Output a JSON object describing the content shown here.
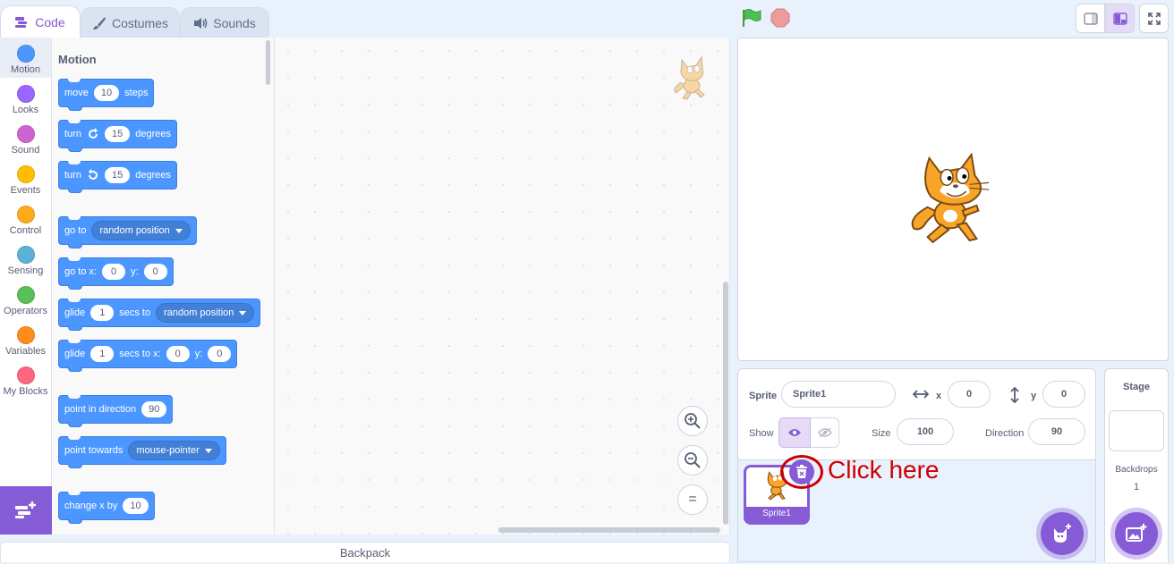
{
  "tabs": {
    "code": "Code",
    "costumes": "Costumes",
    "sounds": "Sounds"
  },
  "categories": [
    {
      "label": "Motion",
      "color": "#4c97ff"
    },
    {
      "label": "Looks",
      "color": "#9966ff"
    },
    {
      "label": "Sound",
      "color": "#cf63cf"
    },
    {
      "label": "Events",
      "color": "#ffbf00"
    },
    {
      "label": "Control",
      "color": "#ffab19"
    },
    {
      "label": "Sensing",
      "color": "#5cb1d6"
    },
    {
      "label": "Operators",
      "color": "#59c059"
    },
    {
      "label": "Variables",
      "color": "#ff8c1a"
    },
    {
      "label": "My Blocks",
      "color": "#ff6680"
    }
  ],
  "palette": {
    "title": "Motion",
    "move": {
      "a": "move",
      "v": "10",
      "b": "steps"
    },
    "turn_right": {
      "a": "turn",
      "v": "15",
      "b": "degrees"
    },
    "turn_left": {
      "a": "turn",
      "v": "15",
      "b": "degrees"
    },
    "goto": {
      "a": "go to",
      "d": "random position"
    },
    "goto_xy": {
      "a": "go to x:",
      "x": "0",
      "b": "y:",
      "y": "0"
    },
    "glide_to": {
      "a": "glide",
      "v": "1",
      "b": "secs to",
      "d": "random position"
    },
    "glide_xy": {
      "a": "glide",
      "v": "1",
      "b": "secs to x:",
      "x": "0",
      "c": "y:",
      "y": "0"
    },
    "point_dir": {
      "a": "point in direction",
      "v": "90"
    },
    "point_towards": {
      "a": "point towards",
      "d": "mouse-pointer"
    },
    "change_x": {
      "a": "change x by",
      "v": "10"
    }
  },
  "zoom": {
    "in": "+",
    "out": "−",
    "reset": "="
  },
  "backpack": "Backpack",
  "sprite_info": {
    "sprite_label": "Sprite",
    "sprite_name": "Sprite1",
    "x_label": "x",
    "x": "0",
    "y_label": "y",
    "y": "0",
    "show_label": "Show",
    "size_label": "Size",
    "size": "100",
    "direction_label": "Direction",
    "direction": "90"
  },
  "sprite_tile": {
    "name": "Sprite1"
  },
  "annotation": "Click here",
  "stage_pane": {
    "title": "Stage",
    "backdrops_label": "Backdrops",
    "backdrops_count": "1"
  }
}
